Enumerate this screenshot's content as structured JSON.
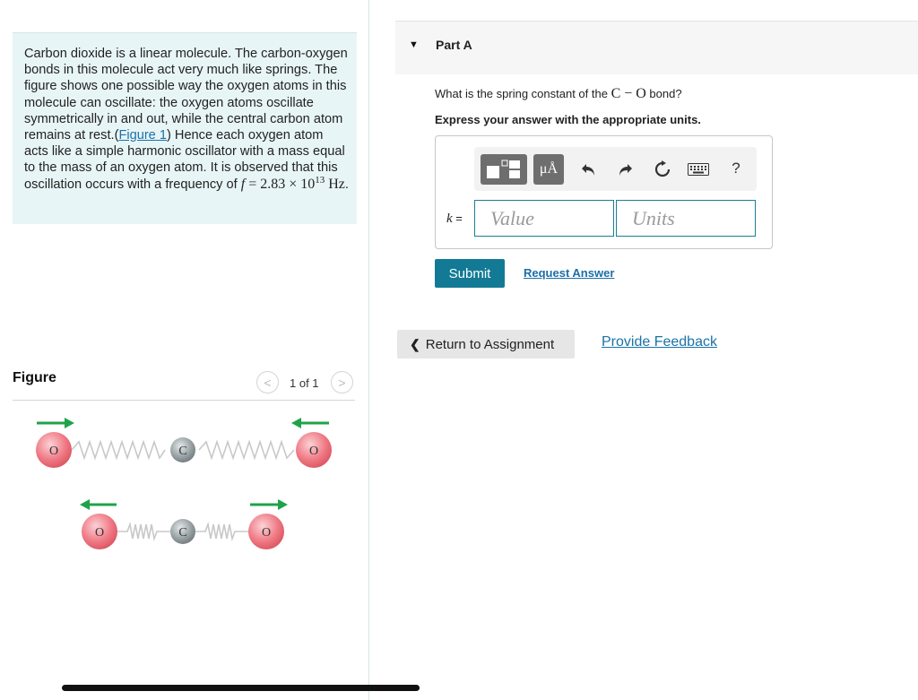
{
  "problem": {
    "text_1": "Carbon dioxide is a linear molecule. The carbon-oxygen bonds in this molecule act very much like springs. The figure shows one possible way the oxygen atoms in this molecule can oscillate: the oxygen atoms oscillate symmetrically in and out, while the central carbon atom remains at rest.(",
    "figure_link": "Figure 1",
    "text_2": ") Hence each oxygen atom acts like a simple harmonic oscillator with a mass equal to the mass of an oxygen atom. It is observed that this oscillation occurs with a frequency of ",
    "freq_var": "f",
    "freq_eq": " = 2.83 × 10",
    "freq_exp": "13",
    "freq_unit": " Hz",
    "end": "."
  },
  "figure": {
    "label": "Figure",
    "page": "1 of 1",
    "prev_icon": "chevron-left-icon",
    "next_icon": "chevron-right-icon",
    "oxygen_label": "O",
    "carbon_label": "C",
    "colors": {
      "oxygen": "#f07b86",
      "carbon": "#9aa3a6",
      "arrow": "#1fa34a",
      "spring": "#c8c8c8"
    }
  },
  "part": {
    "title": "Part A",
    "caret_icon": "triangle-down-icon",
    "question_pre": "What is the spring constant of the ",
    "question_bond": "C − O",
    "question_post": " bond?",
    "instruction": "Express your answer with the appropriate units."
  },
  "toolbar": {
    "templates_icon": "templates-icon",
    "units_label": "μÅ",
    "undo_icon": "undo-icon",
    "redo_icon": "redo-icon",
    "reset_icon": "reset-icon",
    "keyboard_icon": "keyboard-icon",
    "help_label": "?"
  },
  "answer": {
    "var_label": "k",
    "equals": " =",
    "value_placeholder": "Value",
    "units_placeholder": "Units"
  },
  "actions": {
    "submit_label": "Submit",
    "request_answer_label": "Request Answer",
    "return_label": "Return to Assignment",
    "feedback_label": "Provide Feedback"
  }
}
